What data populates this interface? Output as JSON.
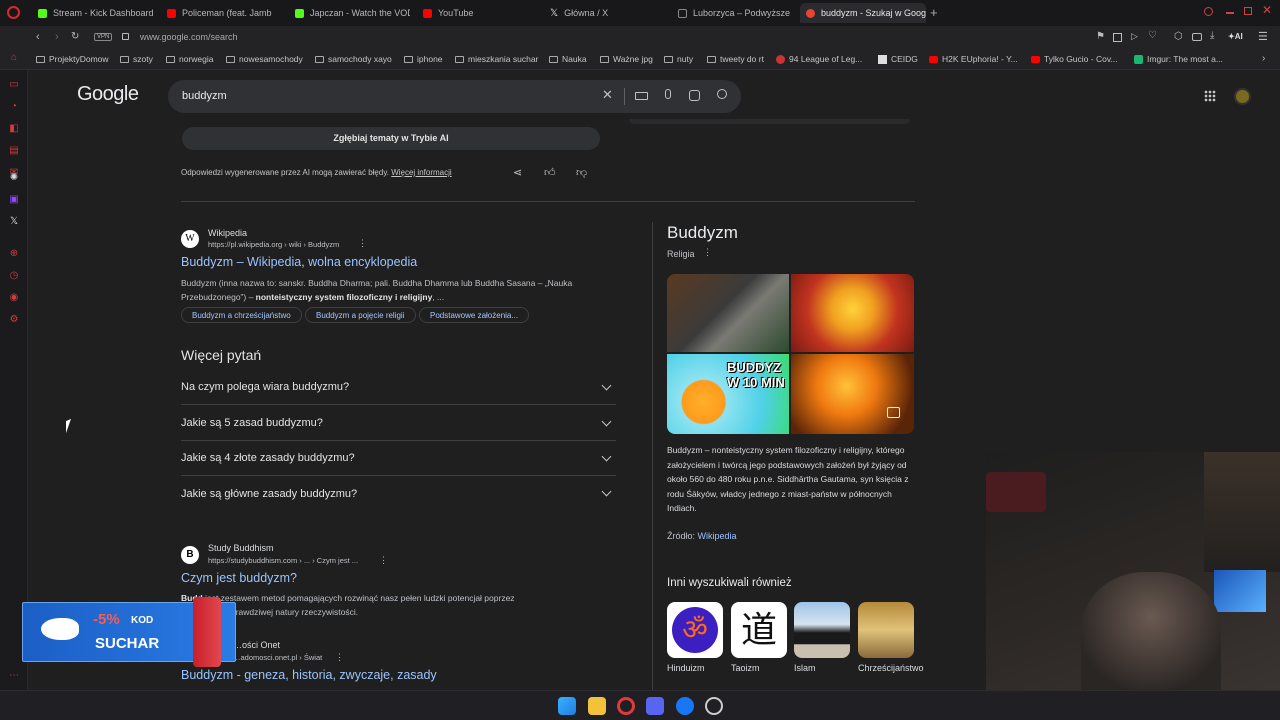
{
  "tabs": [
    {
      "label": "Stream - Kick Dashboard",
      "color": "#53fc18"
    },
    {
      "label": "Policeman (feat. Jamb",
      "color": "#ff0000"
    },
    {
      "label": "Japczan - Watch the VOD",
      "color": "#53fc18"
    },
    {
      "label": "YouTube",
      "color": "#ff0000"
    },
    {
      "label": "Główna / X",
      "color": "#ffffff"
    },
    {
      "label": "Luborzyca – Podwyższenie",
      "color": "#888888"
    },
    {
      "label": "buddyzm - Szukaj w Goog",
      "color": "#ea4335"
    }
  ],
  "address": {
    "vpn": "VPN",
    "url": "www.google.com/search",
    "ai_label": "AI"
  },
  "bookmarks": [
    "ProjektyDomow",
    "szoty",
    "norwegia",
    "nowesamochody",
    "samochody xayo",
    "iphone",
    "mieszkania suchar",
    "Nauka",
    "Ważne jpg",
    "nuty",
    "tweety do rt",
    "94 League of Leg...",
    "CEIDG",
    "H2K EUphoria! - Y...",
    "Tylko Gucio - Cov...",
    "Imgur: The most a..."
  ],
  "google": {
    "logo": "Google",
    "query": "buddyzm",
    "ai_mode_button": "Zgłębiaj tematy w Trybie AI",
    "ai_disclaimer": "Odpowiedzi wygenerowane przez AI mogą zawierać błędy.",
    "ai_more": "Więcej informacji"
  },
  "result1": {
    "site": "Wikipedia",
    "url": "https://pl.wikipedia.org › wiki › Buddyzm",
    "title": "Buddyzm – Wikipedia, wolna encyklopedia",
    "snippet_a": "Buddyzm (inna nazwa to: sanskr. Buddha Dharma; pali. Buddha Dhamma lub Buddha Sasana – „Nauka Przebudzonego”) – ",
    "snippet_bold": "nonteistyczny system filozoficzny i religijny",
    "snippet_b": ", ...",
    "chips": [
      "Buddyzm a chrześcijaństwo",
      "Buddyzm a pojęcie religii",
      "Podstawowe założenia..."
    ]
  },
  "paa": {
    "heading": "Więcej pytań",
    "questions": [
      "Na czym polega wiara buddyzmu?",
      "Jakie są 5 zasad buddyzmu?",
      "Jakie są 4 złote zasady buddyzmu?",
      "Jakie są główne zasady buddyzmu?"
    ]
  },
  "result2": {
    "site": "Study Buddhism",
    "url": "https://studybuddhism.com › ... › Czym jest ...",
    "title": "Czym jest buddyzm?",
    "snippet_1": "Budd",
    "snippet_1b": " jest zestawem metod pomagających rozwinąć nasz pełen ludzki potencjał poprzez",
    "snippet_2": "prawdziwej natury rzeczywistości."
  },
  "result3": {
    "site": "…ości Onet",
    "url": "…adomosci.onet.pl › Świat",
    "title": "Buddyzm - geneza, historia, zwyczaje, zasady"
  },
  "knowledge": {
    "title": "Buddyzm",
    "subtitle": "Religia",
    "image_text": "BUDDYZ W 10 MIN",
    "description": "Buddyzm – nonteistyczny system filozoficzny i religijny, którego założycielem i twórcą jego podstawowych założeń był żyjący od około 560 do 480 roku p.n.e. Siddhārtha Gautama, syn księcia z rodu Śākyów, władcy jednego z miast-państw w północnych Indiach.",
    "source_label": "Źródło:",
    "source_link": "Wikipedia",
    "related_heading": "Inni wyszukiwali również",
    "related": [
      "Hinduizm",
      "Taoizm",
      "Islam",
      "Chrześcijaństwo"
    ]
  },
  "promo": {
    "discount": "-5%",
    "kod": "KOD",
    "code": "SUCHAR"
  }
}
